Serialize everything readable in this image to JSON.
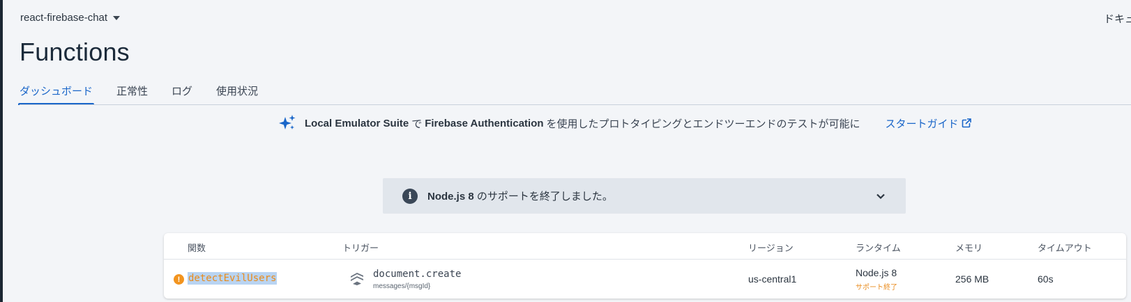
{
  "header": {
    "project": "react-firebase-chat",
    "docs_link": "ドキュ",
    "title": "Functions"
  },
  "tabs": [
    {
      "label": "ダッシュボード",
      "active": true
    },
    {
      "label": "正常性",
      "active": false
    },
    {
      "label": "ログ",
      "active": false
    },
    {
      "label": "使用状況",
      "active": false
    }
  ],
  "promo": {
    "product1": "Local Emulator Suite",
    "joiner": "で",
    "product2": "Firebase Authentication",
    "text": "を使用したプロトタイピングとエンドツーエンドのテストが可能に",
    "link": "スタートガイド",
    "icon": "sparkle-icon"
  },
  "notice": {
    "bold": "Node.js 8",
    "text": " のサポートを終了しました。",
    "icon": "info-icon"
  },
  "table": {
    "headers": {
      "function": "関数",
      "trigger": "トリガー",
      "region": "リージョン",
      "runtime": "ランタイム",
      "memory": "メモリ",
      "timeout": "タイムアウト"
    },
    "rows": [
      {
        "status_icon": "warning-icon",
        "function": "detectEvilUsers",
        "trigger": "document.create",
        "trigger_path": "messages/{msgId}",
        "region": "us-central1",
        "runtime": "Node.js 8",
        "runtime_note": "サポート終了",
        "memory": "256 MB",
        "timeout": "60s"
      }
    ]
  },
  "colors": {
    "accent": "#1a66c9",
    "warning": "#f2941f",
    "background": "#f3f5f8"
  }
}
